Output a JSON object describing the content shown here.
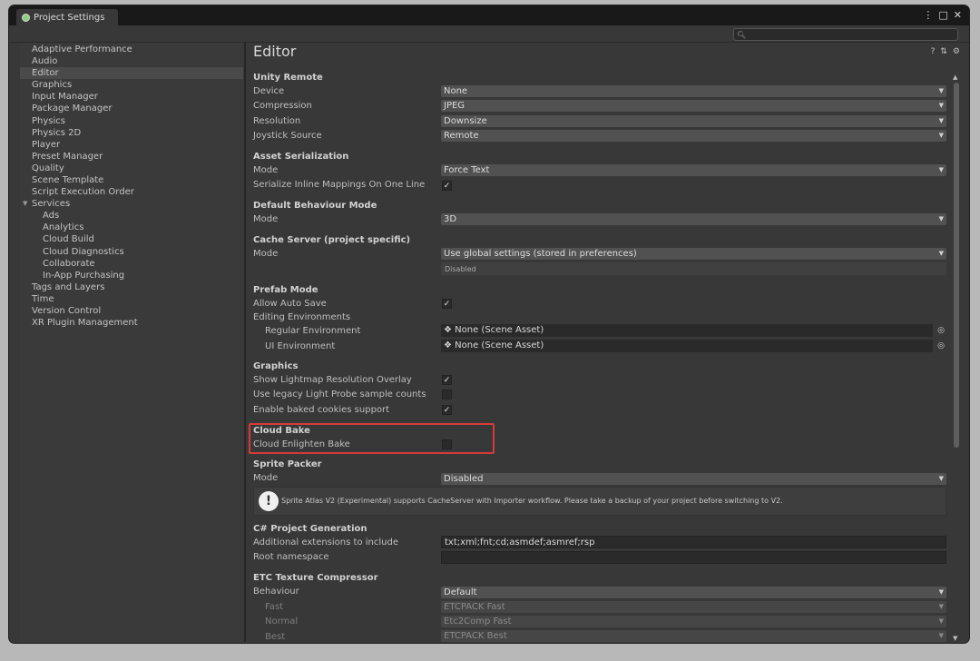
{
  "window": {
    "tab_title": "Project Settings",
    "menu_icon": "⋮",
    "maximize_icon": "□",
    "close_icon": "✕",
    "search_placeholder": ""
  },
  "sidebar": {
    "items": [
      {
        "label": "Adaptive Performance"
      },
      {
        "label": "Audio"
      },
      {
        "label": "Editor"
      },
      {
        "label": "Graphics"
      },
      {
        "label": "Input Manager"
      },
      {
        "label": "Package Manager"
      },
      {
        "label": "Physics"
      },
      {
        "label": "Physics 2D"
      },
      {
        "label": "Player"
      },
      {
        "label": "Preset Manager"
      },
      {
        "label": "Quality"
      },
      {
        "label": "Scene Template"
      },
      {
        "label": "Script Execution Order"
      },
      {
        "label": "Services"
      },
      {
        "label": "Ads"
      },
      {
        "label": "Analytics"
      },
      {
        "label": "Cloud Build"
      },
      {
        "label": "Cloud Diagnostics"
      },
      {
        "label": "Collaborate"
      },
      {
        "label": "In-App Purchasing"
      },
      {
        "label": "Tags and Layers"
      },
      {
        "label": "Time"
      },
      {
        "label": "Version Control"
      },
      {
        "label": "XR Plugin Management"
      }
    ],
    "selected": "Editor"
  },
  "main": {
    "title": "Editor",
    "unity_remote": {
      "heading": "Unity Remote",
      "device_label": "Device",
      "device_value": "None",
      "compression_label": "Compression",
      "compression_value": "JPEG",
      "resolution_label": "Resolution",
      "resolution_value": "Downsize",
      "joystick_label": "Joystick Source",
      "joystick_value": "Remote"
    },
    "asset_serialization": {
      "heading": "Asset Serialization",
      "mode_label": "Mode",
      "mode_value": "Force Text",
      "inline_label": "Serialize Inline Mappings On One Line",
      "inline_checked": true
    },
    "default_behaviour": {
      "heading": "Default Behaviour Mode",
      "mode_label": "Mode",
      "mode_value": "3D"
    },
    "cache_server": {
      "heading": "Cache Server (project specific)",
      "mode_label": "Mode",
      "mode_value": "Use global settings (stored in preferences)",
      "status": "Disabled"
    },
    "prefab_mode": {
      "heading": "Prefab Mode",
      "auto_save_label": "Allow Auto Save",
      "auto_save_checked": true,
      "editing_env_label": "Editing Environments",
      "regular_label": "Regular Environment",
      "regular_value": "None (Scene Asset)",
      "ui_label": "UI Environment",
      "ui_value": "None (Scene Asset)"
    },
    "graphics": {
      "heading": "Graphics",
      "lightmap_label": "Show Lightmap Resolution Overlay",
      "lightmap_checked": true,
      "legacy_probe_label": "Use legacy Light Probe sample counts",
      "legacy_probe_checked": false,
      "cookies_label": "Enable baked cookies support",
      "cookies_checked": true
    },
    "cloud_bake": {
      "heading": "Cloud Bake",
      "enlighten_label": "Cloud Enlighten Bake",
      "enlighten_checked": false
    },
    "sprite_packer": {
      "heading": "Sprite Packer",
      "mode_label": "Mode",
      "mode_value": "Disabled",
      "warning": "Sprite Atlas V2 (Experimental) supports CacheServer with Importer workflow. Please take a backup of your project before switching to V2."
    },
    "csharp": {
      "heading": "C# Project Generation",
      "extensions_label": "Additional extensions to include",
      "extensions_value": "txt;xml;fnt;cd;asmdef;asmref;rsp",
      "namespace_label": "Root namespace",
      "namespace_value": ""
    },
    "etc": {
      "heading": "ETC Texture Compressor",
      "behaviour_label": "Behaviour",
      "behaviour_value": "Default",
      "fast_label": "Fast",
      "fast_value": "ETCPACK Fast",
      "normal_label": "Normal",
      "normal_value": "Etc2Comp Fast",
      "best_label": "Best",
      "best_value": "ETCPACK Best"
    }
  },
  "colors": {
    "highlight": "#d83a3a",
    "background": "#383838"
  }
}
